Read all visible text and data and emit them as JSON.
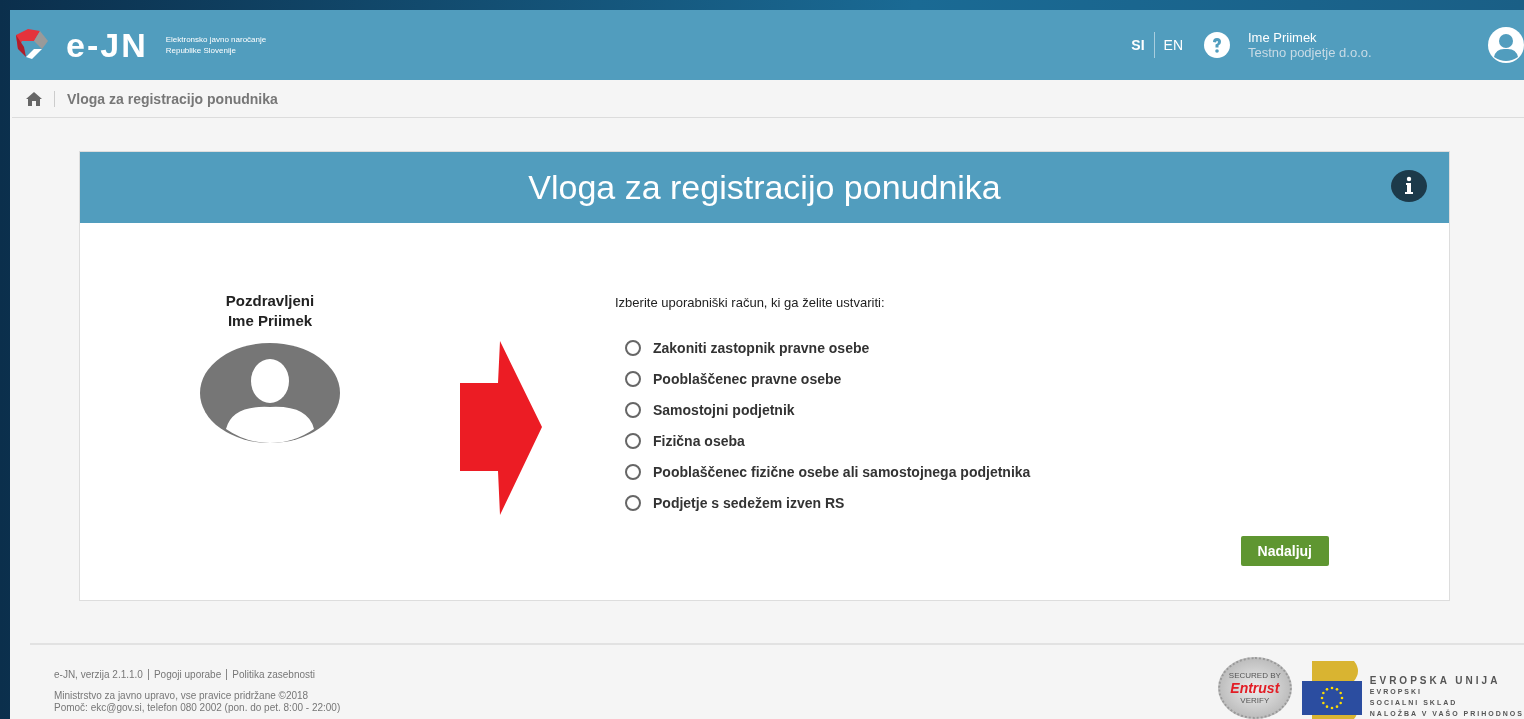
{
  "header": {
    "logo_text": "e-JN",
    "logo_subtitle": [
      "Elektronsko javno naročanje",
      "Republike Slovenije"
    ],
    "languages": [
      {
        "label": "SI",
        "selected": true
      },
      {
        "label": "EN",
        "selected": false
      }
    ],
    "user": {
      "name": "Ime Priimek",
      "company": "Testno podjetje d.o.o."
    }
  },
  "breadcrumb": {
    "current": "Vloga za registracijo ponudnika"
  },
  "card": {
    "title": "Vloga za registracijo ponudnika",
    "greeting": [
      "Pozdravljeni",
      "Ime Priimek"
    ],
    "prompt": "Izberite uporabniški račun, ki ga želite ustvariti:",
    "options": [
      {
        "label": "Zakoniti zastopnik pravne osebe",
        "selected": false
      },
      {
        "label": "Pooblaščenec pravne osebe",
        "selected": false
      },
      {
        "label": "Samostojni podjetnik",
        "selected": false
      },
      {
        "label": "Fizična oseba",
        "selected": false
      },
      {
        "label": "Pooblaščenec fizične osebe ali samostojnega podjetnika",
        "selected": false
      },
      {
        "label": "Podjetje s sedežem izven RS",
        "selected": false
      }
    ],
    "button": "Nadaljuj"
  },
  "footer": {
    "links": [
      "e-JN, verzija 2.1.1.0",
      "Pogoji uporabe",
      "Politika zasebnosti"
    ],
    "lines": [
      "Ministrstvo za javno upravo, vse pravice pridržane ©2018",
      "Pomoč: ekc@gov.si, telefon 080 2002 (pon. do pet. 8:00 - 22:00)"
    ],
    "seal": {
      "top": "SECURED BY",
      "brand": "Entrust",
      "bottom": "VERIFY"
    },
    "eu": [
      "EVROPSKA UNIJA",
      "EVROPSKI",
      "SOCIALNI SKLAD",
      "NALOŽBA V VAŠO PRIHODNOS"
    ]
  }
}
